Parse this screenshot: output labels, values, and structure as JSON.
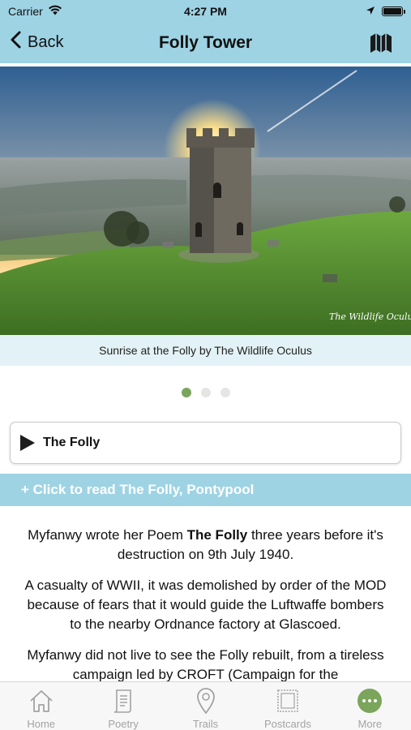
{
  "status_bar": {
    "carrier": "Carrier",
    "time": "4:27 PM",
    "wifi_icon": "wifi-icon",
    "location_icon": "location-arrow-icon",
    "battery_icon": "battery-full-icon",
    "battery_level": 1.0
  },
  "nav": {
    "back_label": "Back",
    "title": "Folly Tower",
    "map_icon": "folded-map-icon"
  },
  "hero": {
    "watermark": "The Wildlife Oculus",
    "caption": "Sunrise at the Folly by The Wildlife Oculus"
  },
  "carousel": {
    "page_count": 3,
    "current_page": 1
  },
  "audio": {
    "label": "The Folly",
    "icon": "play-icon"
  },
  "read_more": {
    "label": "+ Click to read The Folly, Pontypool"
  },
  "body": {
    "p1_before": "Myfanwy wrote her Poem ",
    "p1_bold": "The Folly",
    "p1_after": " three years before it's destruction on 9th July 1940.",
    "p2": "A casualty of WWII, it was demolished by order of the MOD because of fears that it would guide the Luftwaffe bombers to the nearby Ordnance factory at Glascoed.",
    "p3": "Myfanwy did not live to see the Folly rebuilt, from a tireless campaign led by CROFT (Campaign for the"
  },
  "tabs": [
    {
      "label": "Home",
      "icon": "home-icon",
      "active": false
    },
    {
      "label": "Poetry",
      "icon": "scroll-icon",
      "active": false
    },
    {
      "label": "Trails",
      "icon": "map-pin-icon",
      "active": false
    },
    {
      "label": "Postcards",
      "icon": "postcard-icon",
      "active": false
    },
    {
      "label": "More",
      "icon": "more-icon",
      "active": true
    }
  ],
  "colors": {
    "header": "#9ed3e4",
    "caption_bg": "#e3f2f6",
    "active_green": "#7aa55b",
    "tab_inactive": "#a3a3a3"
  }
}
